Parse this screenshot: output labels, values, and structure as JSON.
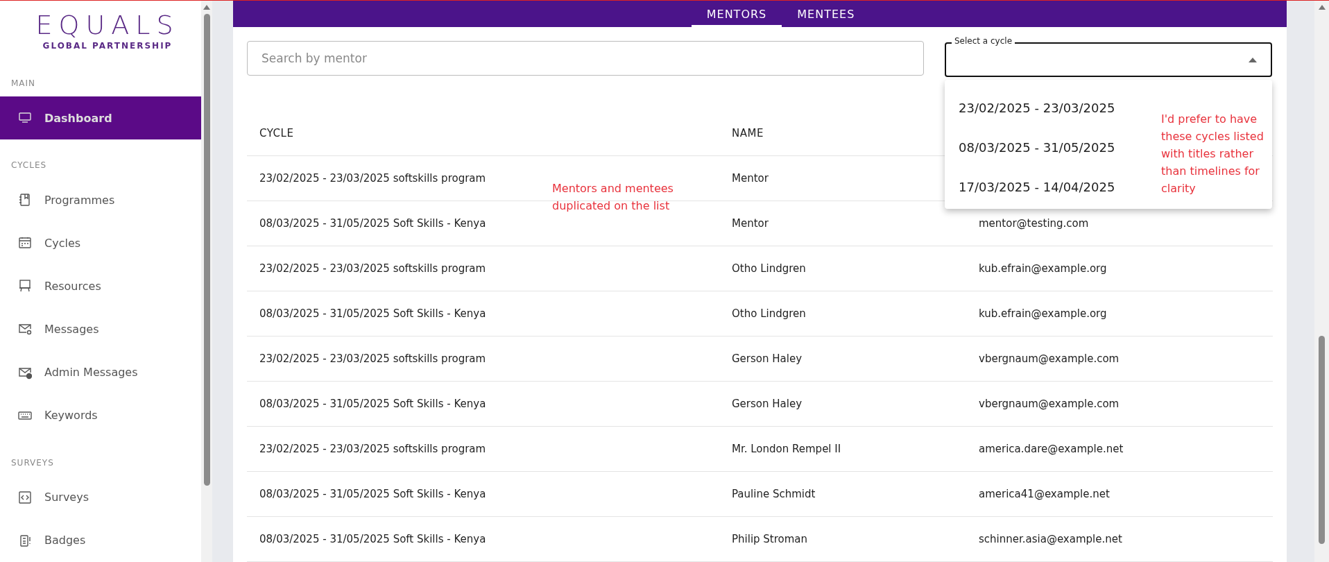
{
  "sidebar": {
    "logo": {
      "title": "EQUALS",
      "subtitle": "GLOBAL PARTNERSHIP"
    },
    "sections": [
      {
        "heading": "MAIN",
        "items": [
          {
            "label": "Dashboard",
            "kind": "monitor",
            "selected": true
          }
        ]
      },
      {
        "heading": "CYCLES",
        "items": [
          {
            "label": "Programmes",
            "kind": "notebook",
            "selected": false
          },
          {
            "label": "Cycles",
            "kind": "calendar",
            "selected": false
          },
          {
            "label": "Resources",
            "kind": "easel",
            "selected": false
          },
          {
            "label": "Messages",
            "kind": "mail-at",
            "selected": false
          },
          {
            "label": "Admin Messages",
            "kind": "mail-alert",
            "selected": false
          },
          {
            "label": "Keywords",
            "kind": "keyboard",
            "selected": false
          }
        ]
      },
      {
        "heading": "SURVEYS",
        "items": [
          {
            "label": "Surveys",
            "kind": "code",
            "selected": false
          },
          {
            "label": "Badges",
            "kind": "badge",
            "selected": false
          }
        ]
      }
    ]
  },
  "tabs": [
    {
      "label": "MENTORS",
      "selected": true
    },
    {
      "label": "MENTEES",
      "selected": false
    }
  ],
  "search": {
    "placeholder": "Search by mentor"
  },
  "cycle_select": {
    "label": "Select a cycle",
    "expanded": true,
    "options": [
      "23/02/2025 - 23/03/2025",
      "08/03/2025 - 31/05/2025",
      "17/03/2025 - 14/04/2025"
    ],
    "note": "I'd prefer to have these cycles listed with titles rather than timelines for clarity"
  },
  "table": {
    "columns": [
      "CYCLE",
      "NAME"
    ],
    "note": "Mentors and mentees duplicated on the list",
    "rows": [
      {
        "cycle": "23/02/2025 - 23/03/2025 softskills program",
        "name": "Mentor"
      },
      {
        "cycle": "08/03/2025 - 31/05/2025 Soft Skills - Kenya",
        "name": "Mentor",
        "email": "mentor@testing.com"
      },
      {
        "cycle": "23/02/2025 - 23/03/2025 softskills program",
        "name": "Otho Lindgren",
        "email": "kub.efrain@example.org"
      },
      {
        "cycle": "08/03/2025 - 31/05/2025 Soft Skills - Kenya",
        "name": "Otho Lindgren",
        "email": "kub.efrain@example.org"
      },
      {
        "cycle": "23/02/2025 - 23/03/2025 softskills program",
        "name": "Gerson Haley",
        "email": "vbergnaum@example.com"
      },
      {
        "cycle": "08/03/2025 - 31/05/2025 Soft Skills - Kenya",
        "name": "Gerson Haley",
        "email": "vbergnaum@example.com"
      },
      {
        "cycle": "23/02/2025 - 23/03/2025 softskills program",
        "name": "Mr. London Rempel II",
        "email": "america.dare@example.net"
      },
      {
        "cycle": "08/03/2025 - 31/05/2025 Soft Skills - Kenya",
        "name": "Pauline Schmidt",
        "email": "america41@example.net"
      },
      {
        "cycle": "08/03/2025 - 31/05/2025 Soft Skills - Kenya",
        "name": "Philip Stroman",
        "email": "schinner.asia@example.net"
      }
    ]
  }
}
